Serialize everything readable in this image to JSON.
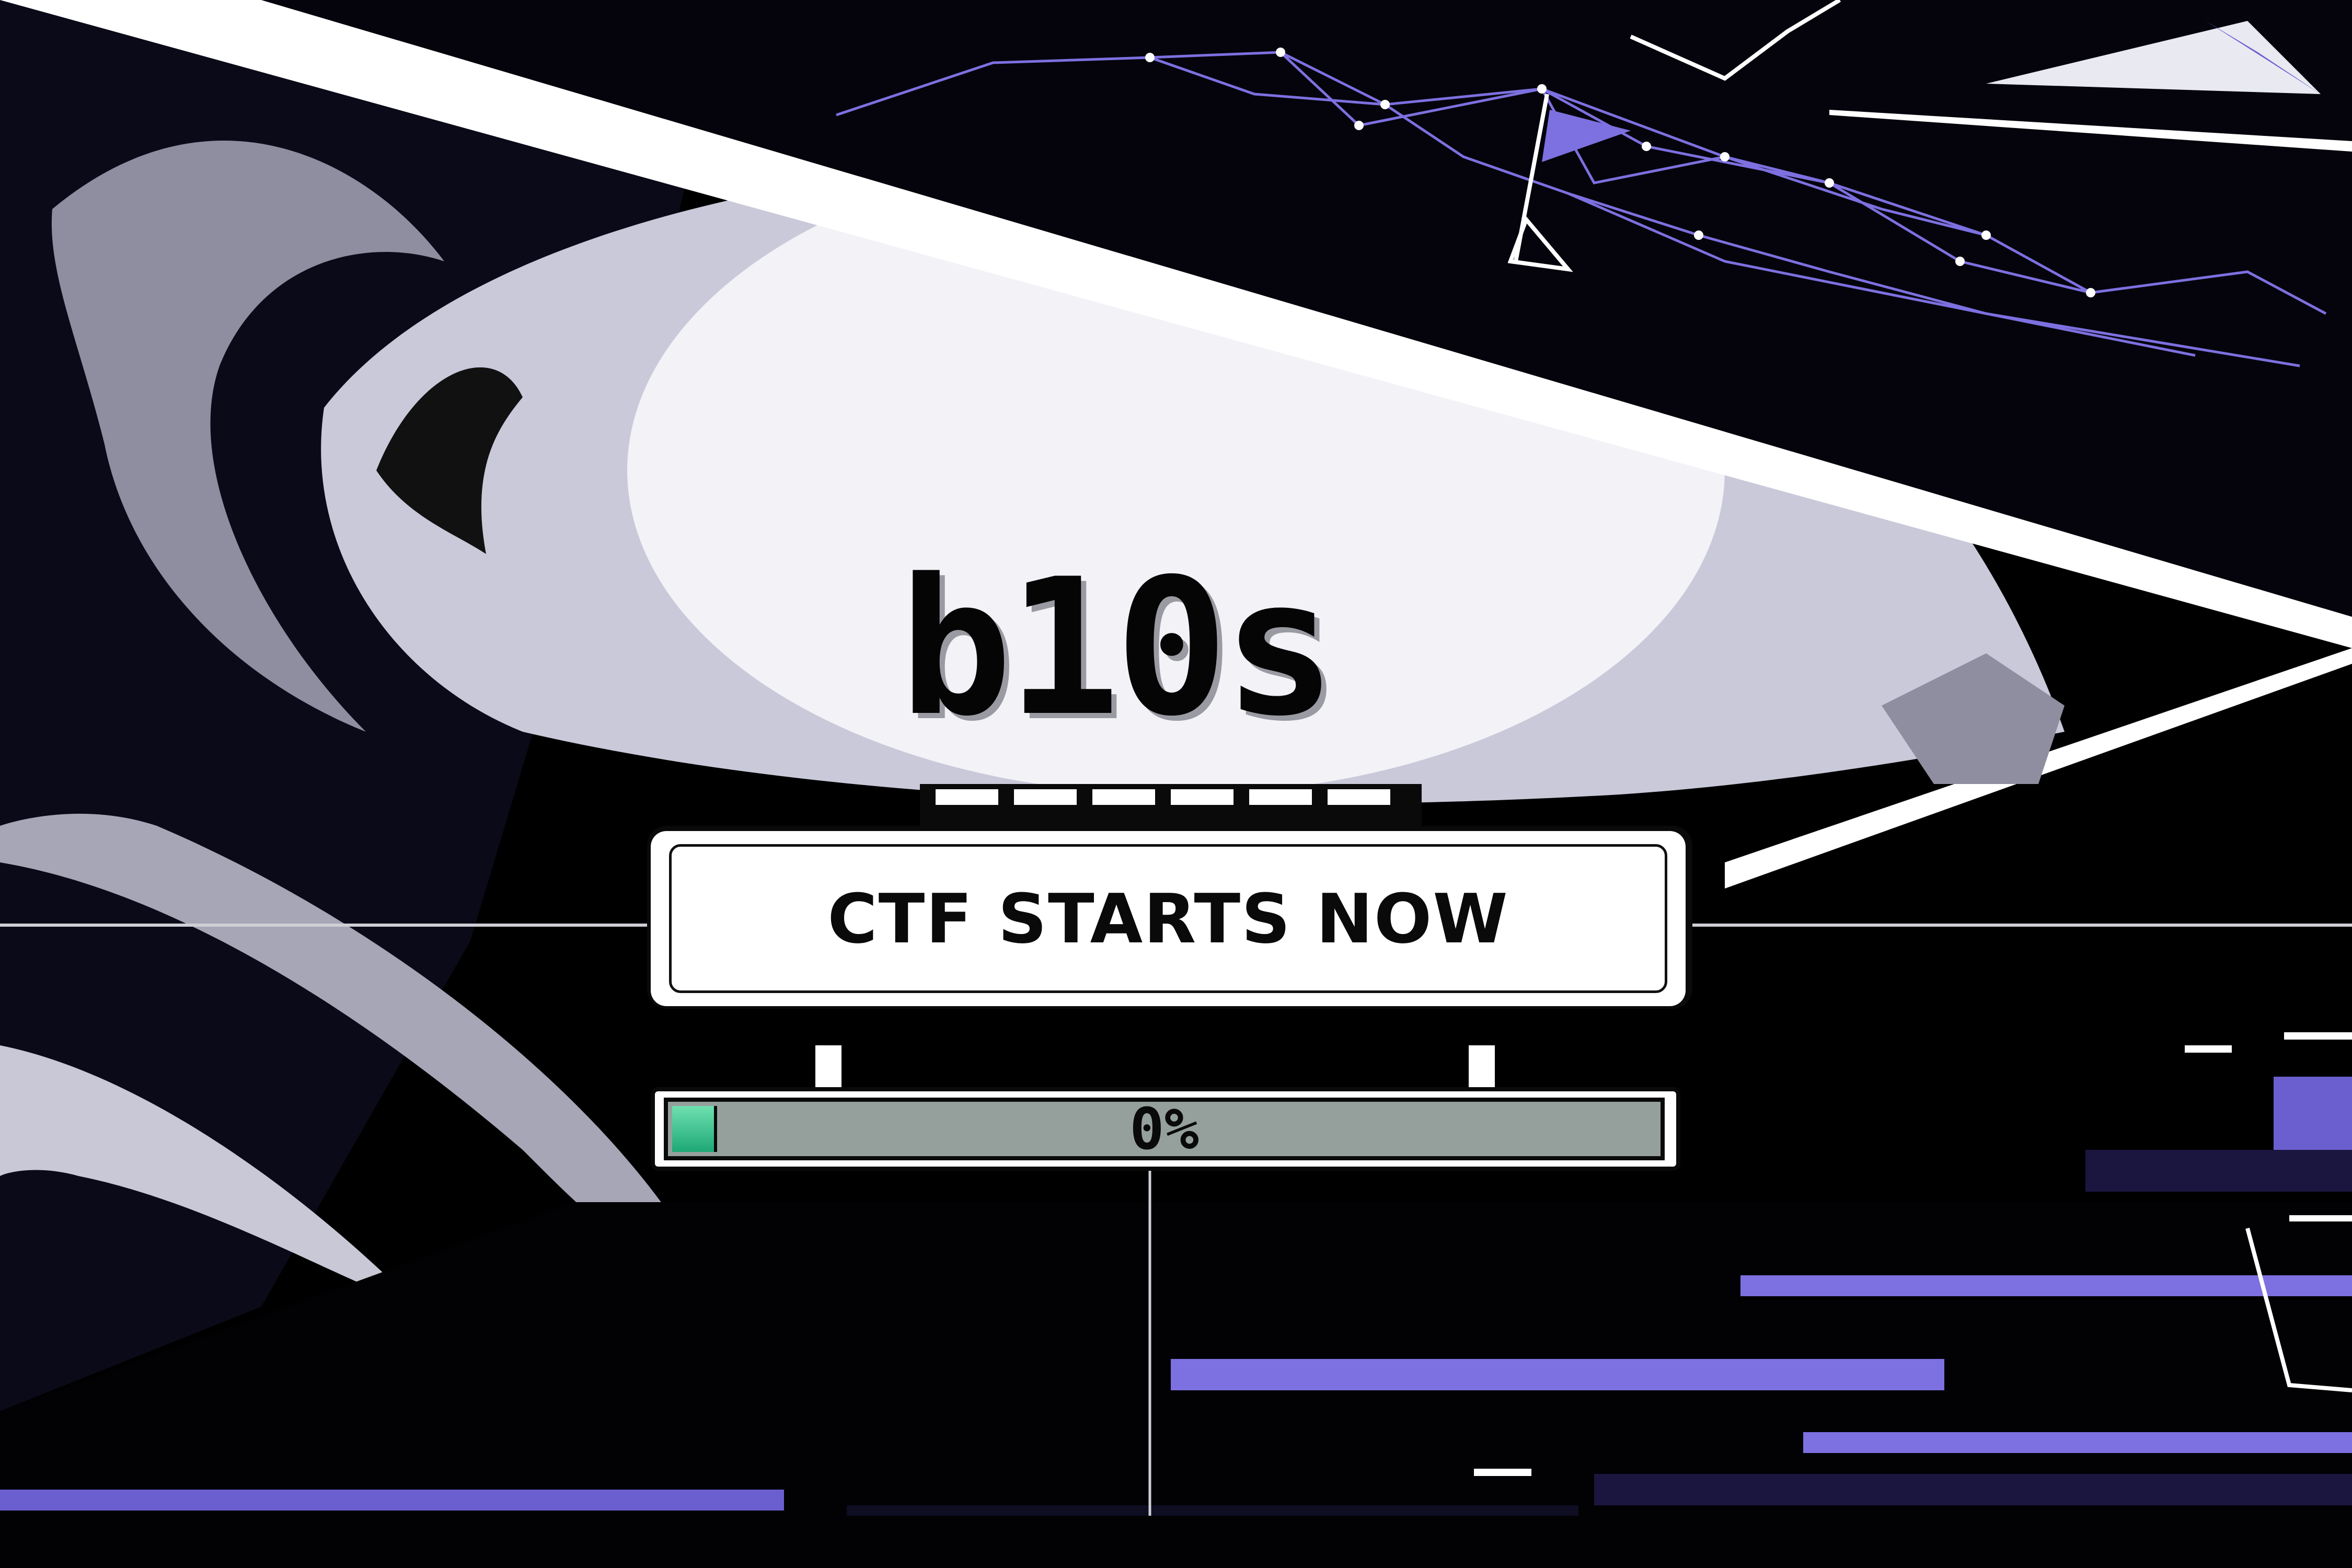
{
  "logo": {
    "prefix": "b",
    "middle": "1",
    "suffix": "0s"
  },
  "banner": {
    "text": "CTF STARTS NOW"
  },
  "progress": {
    "value": 0,
    "label": "0%"
  },
  "colors": {
    "background": "#000000",
    "accent_purple": "#6b5fd0",
    "progress_fill": "#2fbf86",
    "progress_track": "#95a09d",
    "moon": "#f2f2f7"
  }
}
